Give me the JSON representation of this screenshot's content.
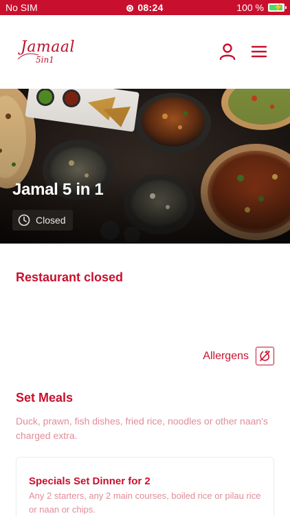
{
  "status_bar": {
    "carrier": "No SIM",
    "time": "08:24",
    "battery": "100 %",
    "battery_level": 1.0,
    "background_color": "#c8102e"
  },
  "header": {
    "logo_line1": "Jamaal",
    "logo_line2": "5in1",
    "icons": [
      "user-icon",
      "menu-icon"
    ]
  },
  "hero": {
    "title": "Jamal 5 in 1",
    "status": "Closed",
    "status_icon": "clock-icon"
  },
  "notice": "Restaurant closed",
  "allergens": {
    "label": "Allergens",
    "icon": "allergen-icon"
  },
  "category": {
    "title": "Set Meals",
    "description": "Duck, prawn, fish dishes, fried rice, noodles or other naan's charged extra.",
    "items": [
      {
        "name": "Specials Set Dinner for 2",
        "description": "Any 2 starters, any 2 main courses, boiled rice or pilau rice or naan or chips."
      }
    ]
  },
  "colors": {
    "accent": "#c8102e",
    "muted_accent": "#e08c98"
  }
}
